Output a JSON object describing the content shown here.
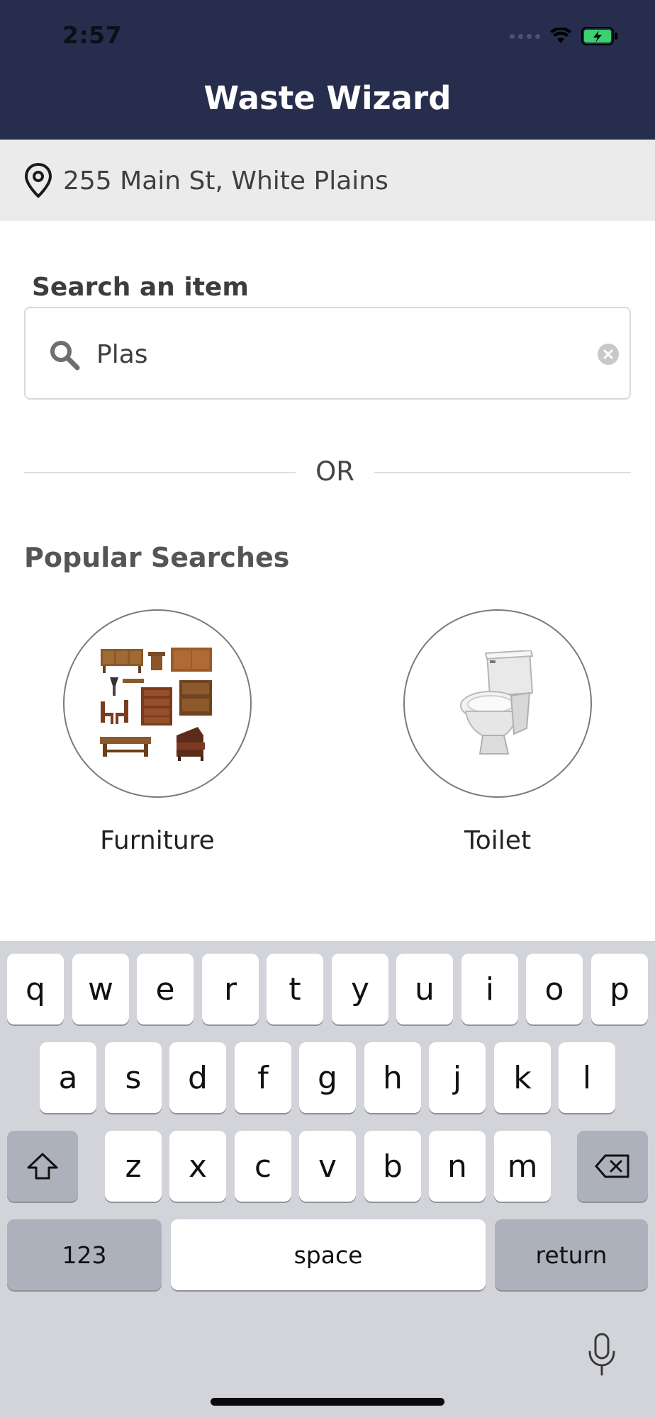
{
  "status": {
    "time": "2:57"
  },
  "header": {
    "title": "Waste Wizard"
  },
  "location": {
    "address": "255 Main St, White Plains",
    "icon": "map-pin-icon"
  },
  "search": {
    "label": "Search an item",
    "value": "Plas"
  },
  "divider": {
    "text": "OR"
  },
  "popular": {
    "title": "Popular Searches",
    "items": [
      {
        "label": "Furniture"
      },
      {
        "label": "Toilet"
      }
    ]
  },
  "keyboard": {
    "row1": [
      "q",
      "w",
      "e",
      "r",
      "t",
      "y",
      "u",
      "i",
      "o",
      "p"
    ],
    "row2": [
      "a",
      "s",
      "d",
      "f",
      "g",
      "h",
      "j",
      "k",
      "l"
    ],
    "row3": [
      "z",
      "x",
      "c",
      "v",
      "b",
      "n",
      "m"
    ],
    "numbers": "123",
    "space": "space",
    "return": "return"
  },
  "colors": {
    "header_bg": "#272e4d",
    "location_bg": "#ebebeb",
    "keyboard_bg": "#d2d4da",
    "battery": "#3bd16f"
  }
}
